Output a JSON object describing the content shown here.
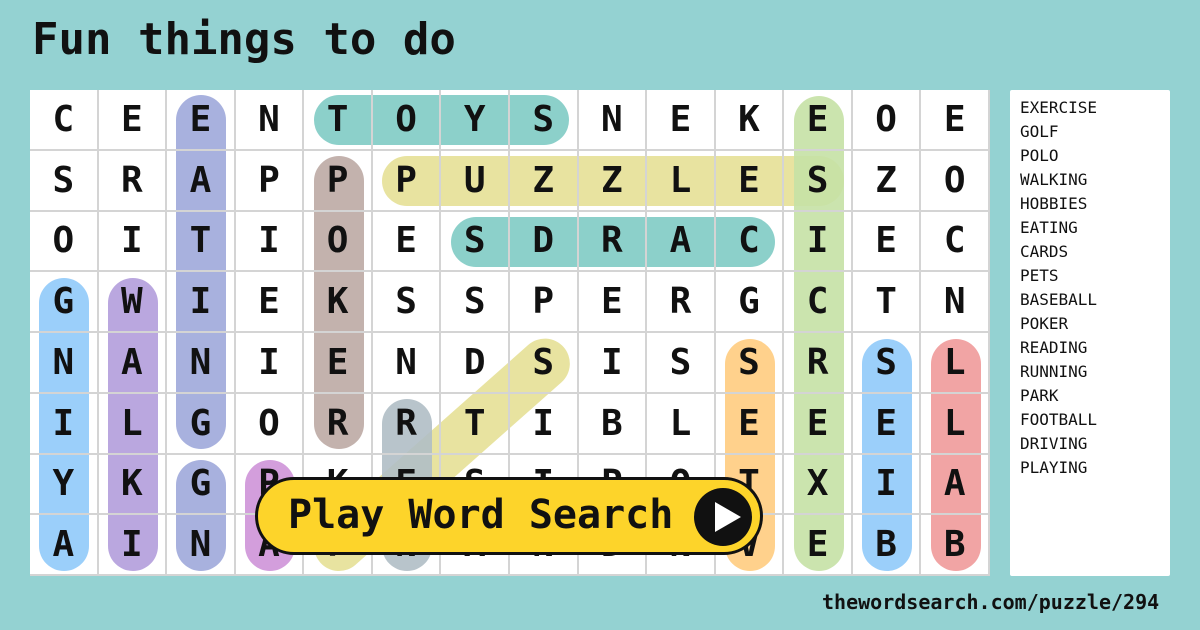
{
  "title": "Fun things to do",
  "grid": [
    [
      "C",
      "E",
      "E",
      "N",
      "T",
      "O",
      "Y",
      "S",
      "N",
      "E",
      "K",
      "E",
      "O",
      "E"
    ],
    [
      "S",
      "R",
      "A",
      "P",
      "P",
      "P",
      "U",
      "Z",
      "Z",
      "L",
      "E",
      "S",
      "Z",
      "O"
    ],
    [
      "O",
      "I",
      "T",
      "I",
      "O",
      "E",
      "S",
      "D",
      "R",
      "A",
      "C",
      "I",
      "E",
      "C"
    ],
    [
      "G",
      "W",
      "I",
      "E",
      "K",
      "S",
      "S",
      "P",
      "E",
      "R",
      "G",
      "C",
      "T",
      "N"
    ],
    [
      "N",
      "A",
      "N",
      "I",
      "E",
      "N",
      "D",
      "S",
      "I",
      "S",
      "S",
      "R",
      "S",
      "L"
    ],
    [
      "I",
      "L",
      "G",
      "O",
      "R",
      "R",
      "T",
      "I",
      "B",
      "L",
      "E",
      "E",
      "E",
      "L"
    ],
    [
      "Y",
      "K",
      "G",
      "P",
      "K",
      "E",
      "S",
      "I",
      "P",
      "O",
      "T",
      "X",
      "I",
      "A"
    ],
    [
      "A",
      "I",
      "N",
      "A",
      "F",
      "N",
      "A",
      "N",
      "D",
      "N",
      "V",
      "E",
      "B",
      "B"
    ]
  ],
  "highlights": [
    {
      "word": "EATING",
      "color": "#9fa8da",
      "from": [
        0,
        2
      ],
      "to": [
        5,
        2
      ]
    },
    {
      "word": "TOYS",
      "color": "#80cbc4",
      "from": [
        0,
        4
      ],
      "to": [
        0,
        7
      ]
    },
    {
      "word": "PUZZLES",
      "color": "#e6e096",
      "from": [
        1,
        5
      ],
      "to": [
        1,
        11
      ]
    },
    {
      "word": "CARDS",
      "color": "#80cbc4",
      "from": [
        2,
        10
      ],
      "to": [
        2,
        6
      ]
    },
    {
      "word": "POKER",
      "color": "#bcaaa4",
      "from": [
        1,
        4
      ],
      "to": [
        5,
        4
      ]
    },
    {
      "word": "EXERCISE",
      "color": "#c5e1a5",
      "from": [
        7,
        11
      ],
      "to": [
        0,
        11
      ]
    },
    {
      "word": "PLAYING",
      "color": "#90caf9",
      "from": [
        7,
        0
      ],
      "to": [
        3,
        0
      ]
    },
    {
      "word": "WALKING",
      "color": "#b39ddb",
      "from": [
        3,
        1
      ],
      "to": [
        7,
        1
      ]
    },
    {
      "word": "DRIVING",
      "color": "#9fa8da",
      "from": [
        7,
        2
      ],
      "to": [
        6,
        2
      ]
    },
    {
      "word": "PARK",
      "color": "#ce93d8",
      "from": [
        6,
        3
      ],
      "to": [
        7,
        3
      ]
    },
    {
      "word": "FOOTBALL",
      "color": "#e6e096",
      "from": [
        7,
        4
      ],
      "to": [
        4,
        7
      ]
    },
    {
      "word": "RUNNING",
      "color": "#b0bec5",
      "from": [
        5,
        5
      ],
      "to": [
        7,
        5
      ]
    },
    {
      "word": "PETS",
      "color": "#ffcc80",
      "from": [
        7,
        10
      ],
      "to": [
        4,
        10
      ]
    },
    {
      "word": "HOBBIES",
      "color": "#90caf9",
      "from": [
        7,
        12
      ],
      "to": [
        4,
        12
      ]
    },
    {
      "word": "BASEBALL",
      "color": "#ef9a9a",
      "from": [
        7,
        13
      ],
      "to": [
        4,
        13
      ]
    }
  ],
  "words": [
    "EXERCISE",
    "GOLF",
    "POLO",
    "WALKING",
    "HOBBIES",
    "EATING",
    "CARDS",
    "PETS",
    "BASEBALL",
    "POKER",
    "READING",
    "RUNNING",
    "PARK",
    "FOOTBALL",
    "DRIVING",
    "PLAYING"
  ],
  "play_button": {
    "label": "Play Word Search",
    "icon": "play-icon"
  },
  "url": "thewordsearch.com/puzzle/294"
}
